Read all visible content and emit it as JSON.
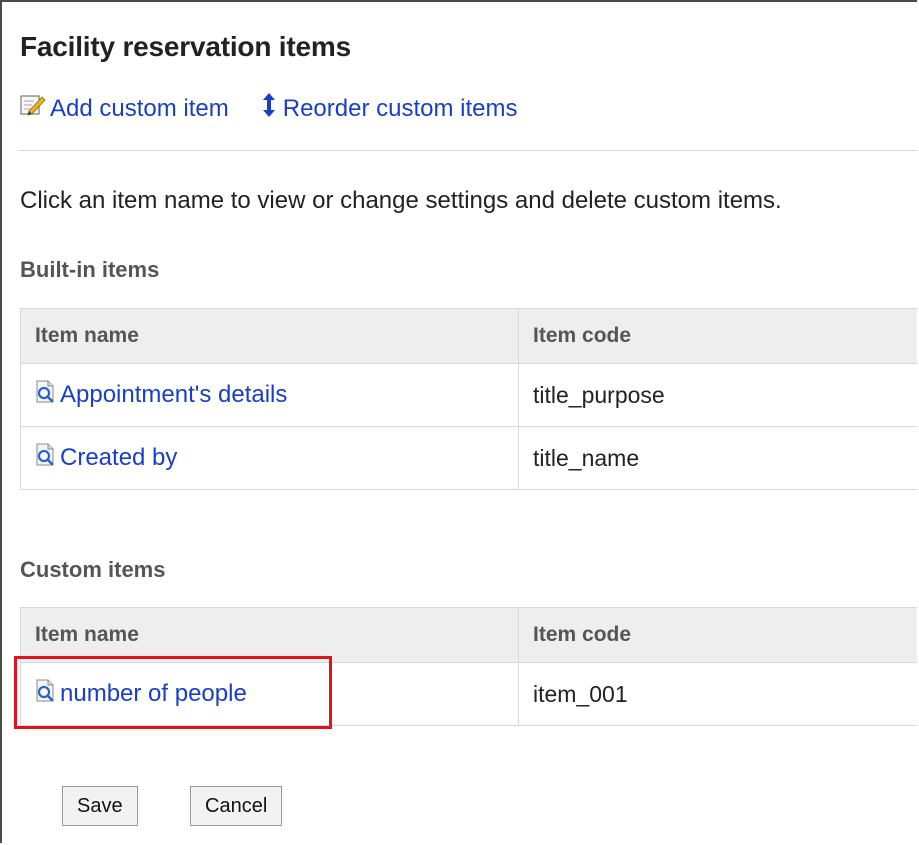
{
  "page": {
    "title": "Facility reservation items",
    "actions": {
      "add_label": "Add custom item",
      "reorder_label": "Reorder custom items"
    },
    "description": "Click an item name to view or change settings and delete custom items."
  },
  "builtin": {
    "heading": "Built-in items",
    "columns": [
      "Item name",
      "Item code"
    ],
    "rows": [
      {
        "name": "Appointment's details",
        "code": "title_purpose"
      },
      {
        "name": "Created by",
        "code": "title_name"
      }
    ]
  },
  "custom": {
    "heading": "Custom items",
    "columns": [
      "Item name",
      "Item code"
    ],
    "rows": [
      {
        "name": "number of people",
        "code": "item_001"
      }
    ]
  },
  "buttons": {
    "save": "Save",
    "cancel": "Cancel"
  },
  "icons": {
    "add": "edit-note-icon",
    "reorder": "up-down-arrow-icon",
    "item": "magnifier-document-icon"
  },
  "colors": {
    "link": "#1a3fc4",
    "highlight": "#e0141e",
    "header_bg": "#eeeeee"
  }
}
